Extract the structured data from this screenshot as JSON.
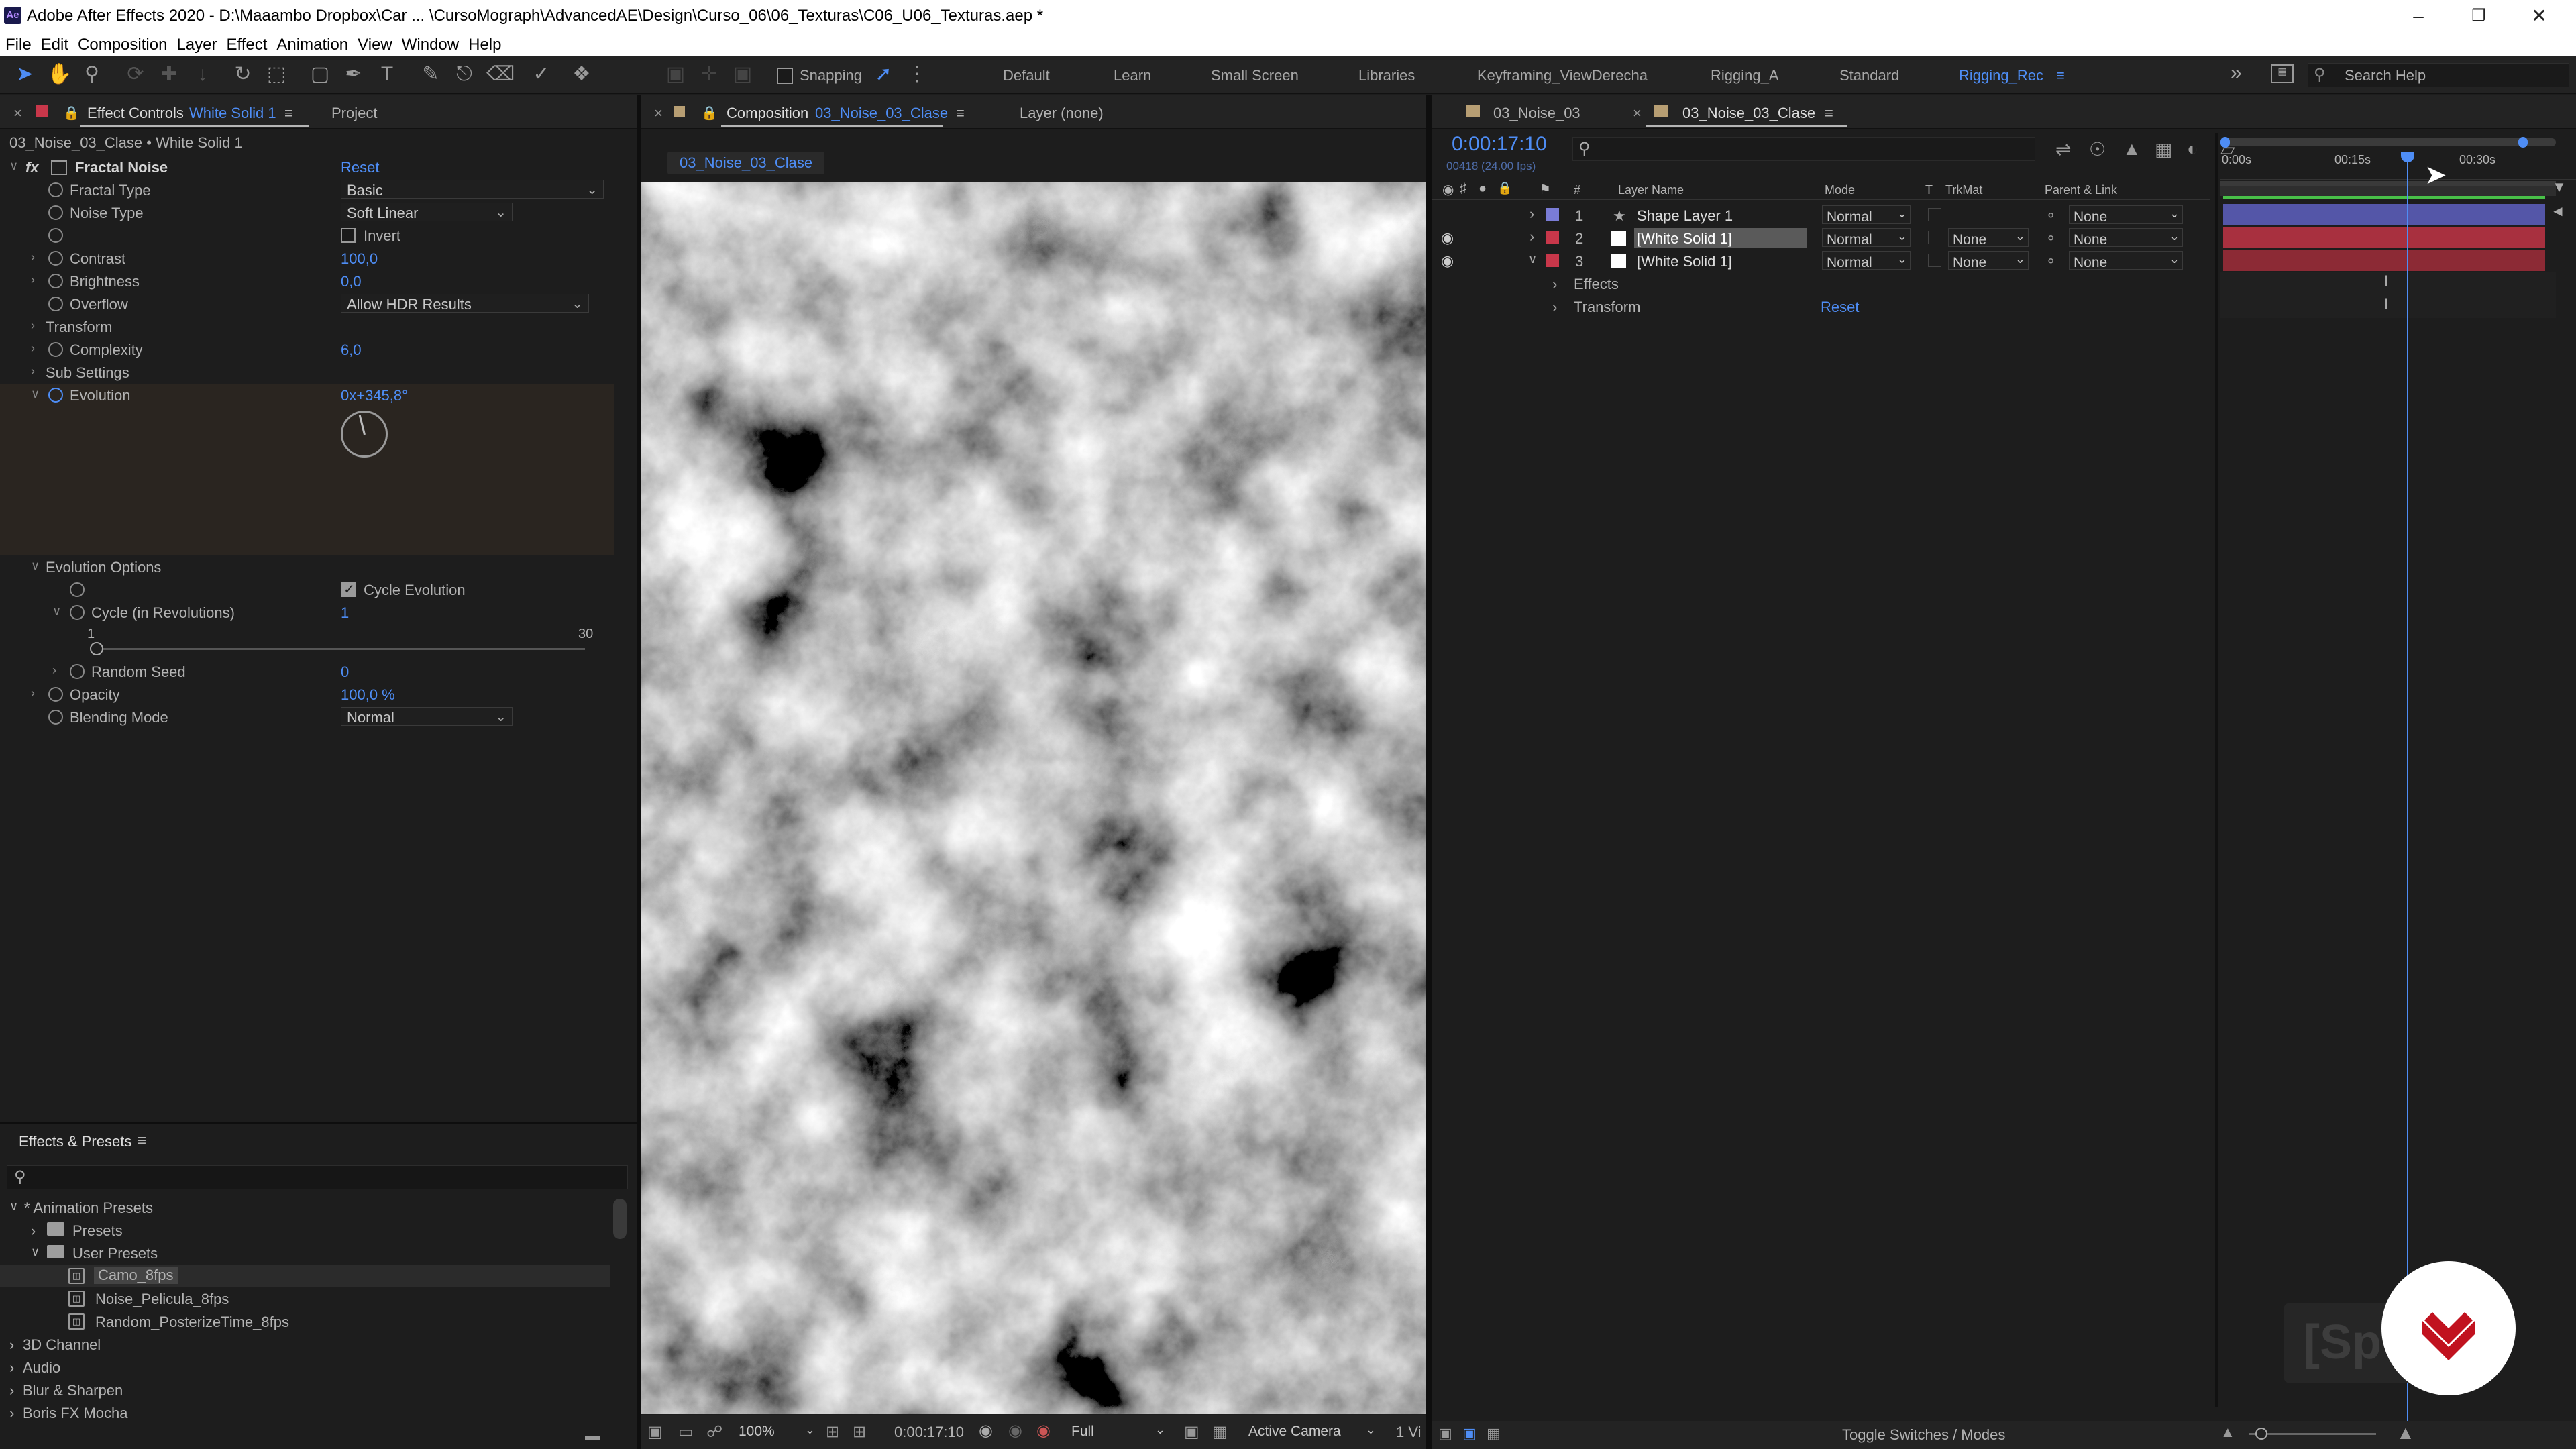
{
  "titlebar": {
    "app_title": "Adobe After Effects 2020 - D:\\Maaambo Dropbox\\Car ... \\CursoMograph\\AdvancedAE\\Design\\Curso_06\\06_Texturas\\C06_U06_Texturas.aep *",
    "logo_text": "Ae"
  },
  "menu": [
    "File",
    "Edit",
    "Composition",
    "Layer",
    "Effect",
    "Animation",
    "View",
    "Window",
    "Help"
  ],
  "toolbar": {
    "snapping_label": "Snapping",
    "workspaces": [
      "Default",
      "Learn",
      "Small Screen",
      "Libraries",
      "Keyframing_ViewDerecha",
      "Rigging_A",
      "Standard",
      "Rigging_Rec"
    ],
    "active_workspace": "Rigging_Rec",
    "search_placeholder": "Search Help",
    "overflow": "»"
  },
  "effect_controls": {
    "tab_label": "Effect Controls",
    "tab_layer": "White Solid 1",
    "project_tab": "Project",
    "breadcrumb": "03_Noise_03_Clase • White Solid 1",
    "effect_name": "Fractal Noise",
    "reset_label": "Reset",
    "fractal_type_label": "Fractal Type",
    "fractal_type_value": "Basic",
    "noise_type_label": "Noise Type",
    "noise_type_value": "Soft Linear",
    "invert_label": "Invert",
    "contrast_label": "Contrast",
    "contrast_value": "100,0",
    "brightness_label": "Brightness",
    "brightness_value": "0,0",
    "overflow_label": "Overflow",
    "overflow_value": "Allow HDR Results",
    "transform_label": "Transform",
    "complexity_label": "Complexity",
    "complexity_value": "6,0",
    "sub_settings_label": "Sub Settings",
    "evolution_label": "Evolution",
    "evolution_value": "0x+345,8°",
    "evolution_options_label": "Evolution Options",
    "cycle_evolution_label": "Cycle Evolution",
    "cycle_label": "Cycle (in Revolutions)",
    "cycle_value": "1",
    "slider_min": "1",
    "slider_max": "30",
    "random_seed_label": "Random Seed",
    "random_seed_value": "0",
    "opacity_label": "Opacity",
    "opacity_value": "100,0 %",
    "blending_label": "Blending Mode",
    "blending_value": "Normal"
  },
  "effects_presets": {
    "title": "Effects & Presets",
    "search_icon": "search-icon",
    "items": [
      {
        "label": "* Animation Presets",
        "level": 0,
        "type": "expanded"
      },
      {
        "label": "Presets",
        "level": 1,
        "type": "folder"
      },
      {
        "label": "User Presets",
        "level": 1,
        "type": "folder-open"
      },
      {
        "label": "Camo_8fps",
        "level": 2,
        "type": "preset",
        "selected": true
      },
      {
        "label": "Noise_Pelicula_8fps",
        "level": 2,
        "type": "preset"
      },
      {
        "label": "Random_PosterizeTime_8fps",
        "level": 2,
        "type": "preset"
      },
      {
        "label": "3D Channel",
        "level": 0,
        "type": "collapsed"
      },
      {
        "label": "Audio",
        "level": 0,
        "type": "collapsed"
      },
      {
        "label": "Blur & Sharpen",
        "level": 0,
        "type": "collapsed"
      },
      {
        "label": "Boris FX Mocha",
        "level": 0,
        "type": "collapsed"
      }
    ]
  },
  "composition": {
    "tab_prefix": "Composition",
    "tab_name": "03_Noise_03_Clase",
    "layer_tab": "Layer  (none)",
    "crumb": "03_Noise_03_Clase",
    "zoom": "100%",
    "timecode": "0:00:17:10",
    "resolution": "Full",
    "camera": "Active Camera",
    "views": "1 Vi"
  },
  "timeline": {
    "tab1": "03_Noise_03",
    "tab2": "03_Noise_03_Clase",
    "current_time": "0:00:17:10",
    "frame_info": "00418 (24.00 fps)",
    "headers": {
      "num": "#",
      "name": "Layer Name",
      "mode": "Mode",
      "t": "T",
      "trkmat": "TrkMat",
      "parent": "Parent & Link"
    },
    "layers": [
      {
        "num": "1",
        "name": "Shape Layer 1",
        "mode": "Normal",
        "trkmat": "",
        "parent": "None",
        "color": "#7a7cd6",
        "star": true
      },
      {
        "num": "2",
        "name": "[White Solid 1]",
        "mode": "Normal",
        "trkmat": "None",
        "parent": "None",
        "color": "#c8374a",
        "selected": true
      },
      {
        "num": "3",
        "name": "[White Solid 1]",
        "mode": "Normal",
        "trkmat": "None",
        "parent": "None",
        "color": "#c8374a"
      }
    ],
    "sub_effects": "Effects",
    "sub_transform": "Transform",
    "sub_reset": "Reset",
    "ruler": [
      "0:00s",
      "00:15s",
      "00:30s"
    ],
    "playhead_fraction": 0.555,
    "toggle_label": "Toggle Switches / Modes"
  },
  "watermark": "[Sp",
  "colors": {
    "accent": "#4e8df5",
    "label_red": "#c8374a",
    "label_blue": "#7a7cd6",
    "logo_red": "#c1121f"
  }
}
